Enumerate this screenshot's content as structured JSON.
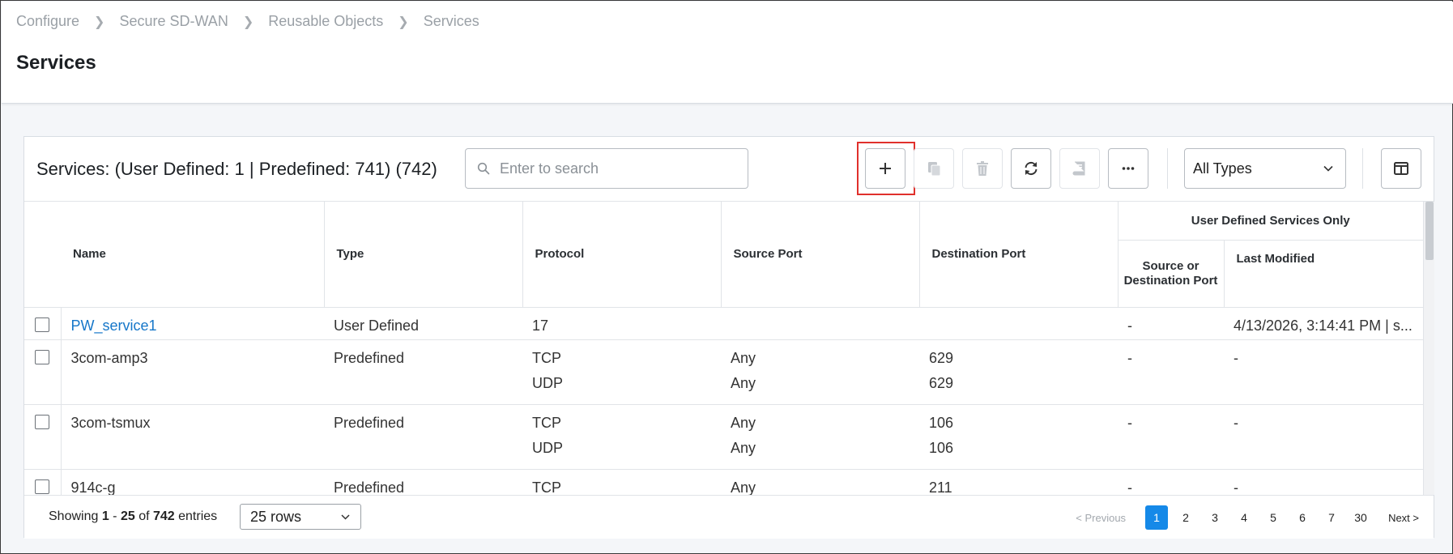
{
  "breadcrumb": [
    "Configure",
    "Secure SD-WAN",
    "Reusable Objects",
    "Services"
  ],
  "page_title": "Services",
  "panel": {
    "title": "Services: (User Defined: 1 | Predefined: 741) (742)",
    "search_placeholder": "Enter to search",
    "type_filter": "All Types"
  },
  "toolbar_icons": [
    "plus-icon",
    "copy-icon",
    "trash-icon",
    "refresh-icon",
    "book-icon",
    "more-icon",
    "columns-icon"
  ],
  "table": {
    "group_header": "User Defined Services Only",
    "columns": [
      "Name",
      "Type",
      "Protocol",
      "Source Port",
      "Destination Port",
      "Source or Destination Port",
      "Last Modified"
    ],
    "rows": [
      {
        "name": "PW_service1",
        "type": "User Defined",
        "lines": [
          {
            "protocol": "17",
            "source": "",
            "dest": ""
          }
        ],
        "sod": "-",
        "modified": "4/13/2026, 3:14:41 PM | s..."
      },
      {
        "name": "3com-amp3",
        "type": "Predefined",
        "lines": [
          {
            "protocol": "TCP",
            "source": "Any",
            "dest": "629"
          },
          {
            "protocol": "UDP",
            "source": "Any",
            "dest": "629"
          }
        ],
        "sod": "-",
        "modified": "-"
      },
      {
        "name": "3com-tsmux",
        "type": "Predefined",
        "lines": [
          {
            "protocol": "TCP",
            "source": "Any",
            "dest": "106"
          },
          {
            "protocol": "UDP",
            "source": "Any",
            "dest": "106"
          }
        ],
        "sod": "-",
        "modified": "-"
      },
      {
        "name": "914c-g",
        "type": "Predefined",
        "lines": [
          {
            "protocol": "TCP",
            "source": "Any",
            "dest": "211"
          }
        ],
        "sod": "-",
        "modified": "-"
      }
    ]
  },
  "footer": {
    "showing_prefix": "Showing ",
    "range_start": "1",
    "range_sep": " - ",
    "range_end": "25",
    "of": " of ",
    "total": "742",
    "suffix": " entries",
    "rows_select": "25 rows",
    "prev": "< Previous",
    "pages": [
      "1",
      "2",
      "3",
      "4",
      "5",
      "6",
      "7",
      "30"
    ],
    "active_page": "1",
    "next": "Next >"
  },
  "colors": {
    "accent": "#1589e8",
    "link": "#1677c9",
    "highlight": "#e0302c"
  }
}
